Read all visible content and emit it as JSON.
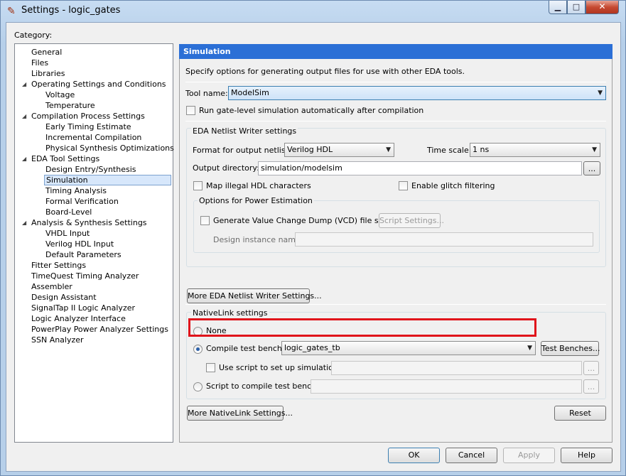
{
  "window": {
    "title": "Settings - logic_gates",
    "title_icon": "pencil-icon",
    "minimize_glyph": "▁",
    "maximize_glyph": "□",
    "close_glyph": "✕"
  },
  "category_label": "Category:",
  "tree": {
    "items": [
      {
        "label": "General",
        "level": 0
      },
      {
        "label": "Files",
        "level": 0
      },
      {
        "label": "Libraries",
        "level": 0
      },
      {
        "label": "Operating Settings and Conditions",
        "level": 0,
        "expander": "◢"
      },
      {
        "label": "Voltage",
        "level": 1
      },
      {
        "label": "Temperature",
        "level": 1
      },
      {
        "label": "Compilation Process Settings",
        "level": 0,
        "expander": "◢"
      },
      {
        "label": "Early Timing Estimate",
        "level": 1
      },
      {
        "label": "Incremental Compilation",
        "level": 1
      },
      {
        "label": "Physical Synthesis Optimizations",
        "level": 1
      },
      {
        "label": "EDA Tool Settings",
        "level": 0,
        "expander": "◢"
      },
      {
        "label": "Design Entry/Synthesis",
        "level": 1
      },
      {
        "label": "Simulation",
        "level": 1,
        "selected": true
      },
      {
        "label": "Timing Analysis",
        "level": 1
      },
      {
        "label": "Formal Verification",
        "level": 1
      },
      {
        "label": "Board-Level",
        "level": 1
      },
      {
        "label": "Analysis & Synthesis Settings",
        "level": 0,
        "expander": "◢"
      },
      {
        "label": "VHDL Input",
        "level": 1
      },
      {
        "label": "Verilog HDL Input",
        "level": 1
      },
      {
        "label": "Default Parameters",
        "level": 1
      },
      {
        "label": "Fitter Settings",
        "level": 0
      },
      {
        "label": "TimeQuest Timing Analyzer",
        "level": 0
      },
      {
        "label": "Assembler",
        "level": 0
      },
      {
        "label": "Design Assistant",
        "level": 0
      },
      {
        "label": "SignalTap II Logic Analyzer",
        "level": 0
      },
      {
        "label": "Logic Analyzer Interface",
        "level": 0
      },
      {
        "label": "PowerPlay Power Analyzer Settings",
        "level": 0
      },
      {
        "label": "SSN Analyzer",
        "level": 0
      }
    ]
  },
  "panel": {
    "header": "Simulation",
    "description": "Specify options for generating output files for use with other EDA tools.",
    "tool_name_label": "Tool name:",
    "tool_name_value": "ModelSim",
    "run_gate_level_label": "Run gate-level simulation automatically after compilation",
    "netlist_group_label": "EDA Netlist Writer settings",
    "format_label": "Format for output netlist:",
    "format_value": "Verilog HDL",
    "time_scale_label": "Time scale:",
    "time_scale_value": "1 ns",
    "output_dir_label": "Output directory:",
    "output_dir_value": "simulation/modelsim",
    "browse_label": "...",
    "map_illegal_label": "Map illegal HDL characters",
    "glitch_label": "Enable glitch filtering",
    "power_group_label": "Options for Power Estimation",
    "vcd_label": "Generate Value Change Dump (VCD) file script",
    "script_settings_label": "Script Settings...",
    "design_instance_label": "Design instance name:",
    "design_instance_value": "",
    "more_netlist_label": "More EDA Netlist Writer Settings...",
    "nativelink_group_label": "NativeLink settings",
    "none_label": "None",
    "compile_tb_label": "Compile test bench:",
    "compile_tb_value": "logic_gates_tb",
    "test_benches_label": "Test Benches...",
    "use_script_label": "Use script to set up simulation:",
    "use_script_value": "",
    "script_compile_label": "Script to compile test bench:",
    "script_compile_value": "",
    "more_nativelink_label": "More NativeLink Settings...",
    "reset_label": "Reset"
  },
  "footer": {
    "ok_label": "OK",
    "cancel_label": "Cancel",
    "apply_label": "Apply",
    "help_label": "Help"
  },
  "colors": {
    "header_blue": "#2b6fd6",
    "highlight_red": "#e0141b",
    "selection": "#d7e7fb"
  }
}
